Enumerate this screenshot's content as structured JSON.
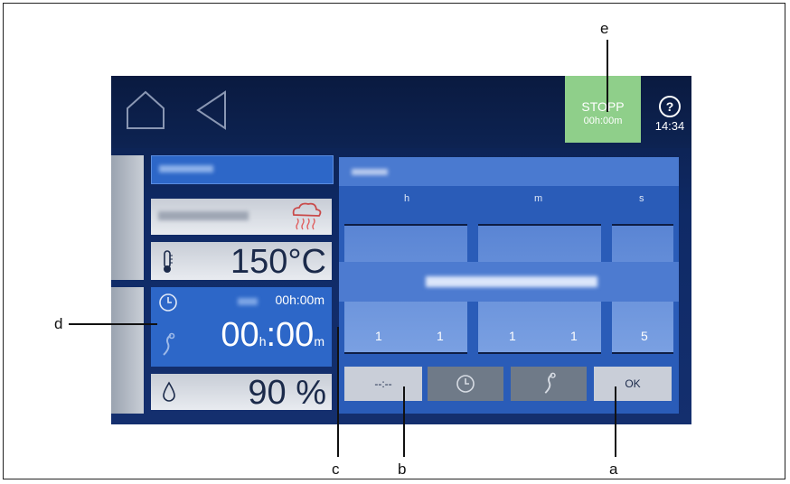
{
  "topbar": {
    "home_icon": "house-outline-icon",
    "back_icon": "triangle-back-icon",
    "stop_label": "STOPP",
    "stop_time": "00h:00m",
    "help_glyph": "?",
    "clock": "14:34"
  },
  "left": {
    "row1_label": "",
    "row2_label": "",
    "steam_icon": "steam-heat-icon",
    "temperature": "150°C",
    "timer_small": "00h:00m",
    "timer_big_h": "00",
    "timer_h_unit": "h",
    "timer_sep": ":",
    "timer_big_m": "00",
    "timer_m_unit": "m",
    "humidity": "90 %"
  },
  "right": {
    "col_h": "h",
    "col_m": "m",
    "col_s": "s",
    "digits": [
      "1",
      "1",
      "1",
      "1",
      "5"
    ],
    "btn_manual": "--:--",
    "btn_ok": "OK"
  },
  "callouts": {
    "a": "a",
    "b": "b",
    "c": "c",
    "d": "d",
    "e": "e"
  },
  "colors": {
    "stop_green": "#8fcf8a",
    "panel_blue": "#2a5cb8"
  }
}
